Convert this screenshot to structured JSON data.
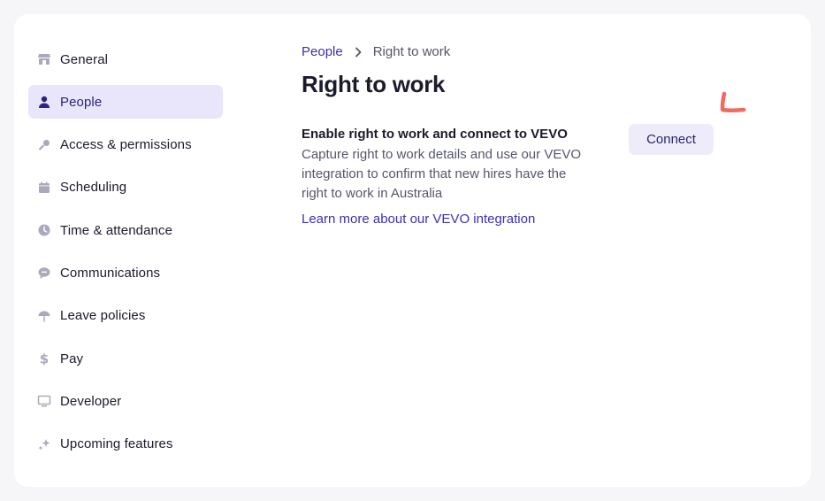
{
  "sidebar": {
    "items": [
      {
        "label": "General",
        "icon": "store-icon"
      },
      {
        "label": "People",
        "icon": "person-icon",
        "active": true
      },
      {
        "label": "Access & permissions",
        "icon": "key-icon"
      },
      {
        "label": "Scheduling",
        "icon": "calendar-icon"
      },
      {
        "label": "Time & attendance",
        "icon": "clock-icon"
      },
      {
        "label": "Communications",
        "icon": "chat-icon"
      },
      {
        "label": "Leave policies",
        "icon": "umbrella-icon"
      },
      {
        "label": "Pay",
        "icon": "dollar-icon"
      },
      {
        "label": "Developer",
        "icon": "monitor-icon"
      },
      {
        "label": "Upcoming features",
        "icon": "sparkle-icon"
      }
    ]
  },
  "breadcrumb": {
    "parent": "People",
    "current": "Right to work"
  },
  "page": {
    "title": "Right to work"
  },
  "section": {
    "title": "Enable right to work and connect to VEVO",
    "description": "Capture right to work details and use our VEVO integration to confirm that new hires have the right to work in Australia",
    "link": "Learn more about our VEVO integration",
    "button": "Connect"
  },
  "colors": {
    "accent": "#3a31b5",
    "active_bg": "#e9e6fb",
    "button_bg": "#eeecf9",
    "annotation": "#f26a5e"
  }
}
